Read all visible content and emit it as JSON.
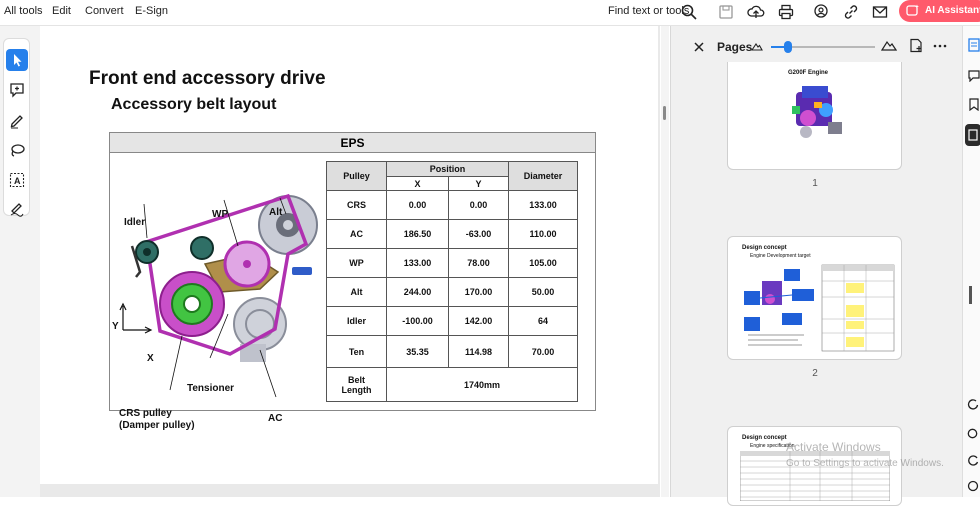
{
  "menu": {
    "all_tools": "All tools",
    "edit": "Edit",
    "convert": "Convert",
    "esign": "E-Sign"
  },
  "toolbar": {
    "find": "Find text or tools",
    "ai_assistant": "AI Assistant"
  },
  "document": {
    "title": "Front end accessory drive",
    "subtitle": "Accessory belt layout",
    "eps_label": "EPS",
    "diagram_labels": {
      "idler": "Idler",
      "wp": "WP",
      "alt": "Alt",
      "y": "Y",
      "x": "X",
      "tensioner": "Tensioner",
      "crs": "CRS pulley",
      "damper": "(Damper pulley)",
      "ac": "AC"
    },
    "table": {
      "h_pulley": "Pulley",
      "h_position": "Position",
      "h_diameter": "Diameter",
      "h_x": "X",
      "h_y": "Y",
      "rows": [
        {
          "pulley": "CRS",
          "x": "0.00",
          "y": "0.00",
          "d": "133.00"
        },
        {
          "pulley": "AC",
          "x": "186.50",
          "y": "-63.00",
          "d": "110.00"
        },
        {
          "pulley": "WP",
          "x": "133.00",
          "y": "78.00",
          "d": "105.00"
        },
        {
          "pulley": "Alt",
          "x": "244.00",
          "y": "170.00",
          "d": "50.00"
        },
        {
          "pulley": "Idler",
          "x": "-100.00",
          "y": "142.00",
          "d": "64"
        },
        {
          "pulley": "Ten",
          "x": "35.35",
          "y": "114.98",
          "d": "70.00"
        }
      ],
      "belt_label_1": "Belt",
      "belt_label_2": "Length",
      "belt_value": "1740mm"
    }
  },
  "panel": {
    "title": "Pages",
    "zoom_fraction": 0.16,
    "thumbs": [
      {
        "num": "1",
        "title": "G200F Engine"
      },
      {
        "num": "2",
        "title": "Design concept",
        "subtitle": "Engine Development target"
      },
      {
        "title": "Design concept",
        "subtitle": "Engine specification"
      }
    ]
  },
  "watermark": {
    "line1": "Activate Windows",
    "line2": "Go to Settings to activate Windows."
  },
  "colors": {
    "accent": "#2680eb",
    "ai": "#ff5a6b",
    "belt": "#b030b0"
  }
}
